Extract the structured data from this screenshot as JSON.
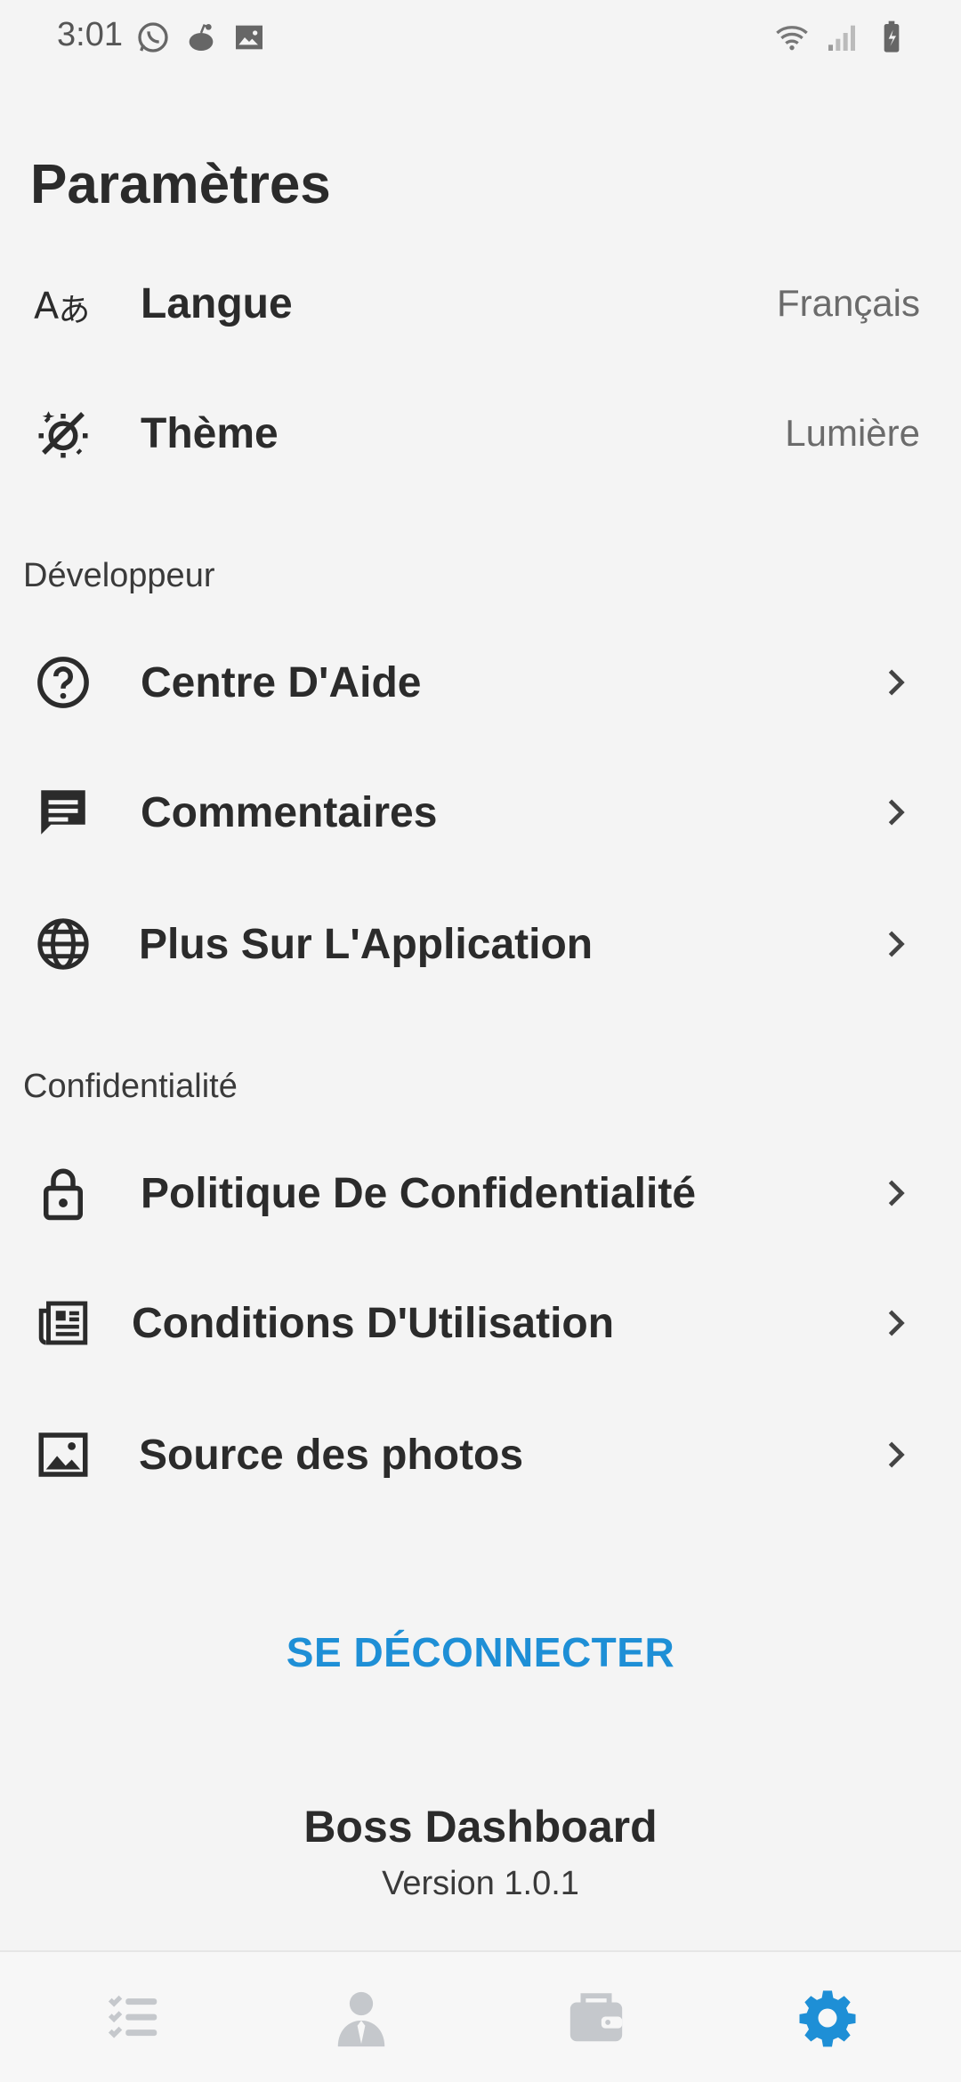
{
  "status_bar": {
    "time": "3:01",
    "icons": [
      "whatsapp-icon",
      "reddit-icon",
      "image-icon",
      "wifi-icon",
      "signal-icon",
      "battery-icon"
    ]
  },
  "page_title": "Paramètres",
  "general": [
    {
      "label": "Langue",
      "value": "Français",
      "icon": "translate-icon"
    },
    {
      "label": "Thème",
      "value": "Lumière",
      "icon": "theme-icon"
    }
  ],
  "developer": {
    "header": "Développeur",
    "items": [
      {
        "label": "Centre D'Aide",
        "icon": "help-icon"
      },
      {
        "label": "Commentaires",
        "icon": "feedback-icon"
      },
      {
        "label": "Plus Sur L'Application",
        "icon": "globe-icon"
      }
    ]
  },
  "privacy": {
    "header": "Confidentialité",
    "items": [
      {
        "label": "Politique De Confidentialité",
        "icon": "lock-icon"
      },
      {
        "label": "Conditions D'Utilisation",
        "icon": "newspaper-icon"
      },
      {
        "label": "Source des photos",
        "icon": "image-icon"
      }
    ]
  },
  "logout_label": "SE DÉCONNECTER",
  "footer": {
    "app_name": "Boss Dashboard",
    "version": "Version 1.0.1"
  },
  "bottom_nav": {
    "items": [
      "tasks-icon",
      "employee-icon",
      "wallet-icon",
      "settings-icon"
    ],
    "active": "settings-icon",
    "active_color": "#1e8fd6",
    "inactive_color": "#c5c8cc"
  },
  "colors": {
    "accent": "#1e8fd6",
    "background": "#f4f4f4",
    "text": "#2b2b2b"
  }
}
